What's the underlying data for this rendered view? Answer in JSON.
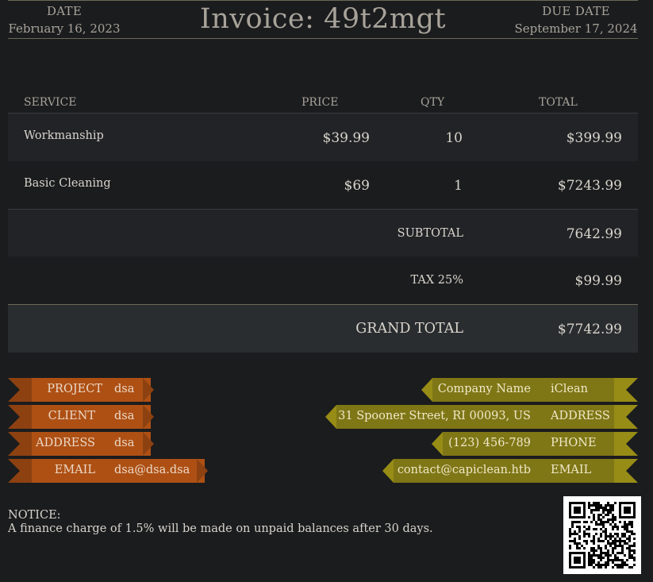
{
  "header": {
    "date_label": "DATE",
    "date_value": "February 16, 2023",
    "title": "Invoice: 49t2mgt",
    "due_label": "DUE DATE",
    "due_value": "September 17, 2024"
  },
  "table": {
    "columns": {
      "service": "SERVICE",
      "price": "PRICE",
      "qty": "QTY",
      "total": "TOTAL"
    },
    "rows": [
      {
        "service": "Workmanship",
        "price": "$39.99",
        "qty": "10",
        "total": "$399.99"
      },
      {
        "service": "Basic Cleaning",
        "price": "$69",
        "qty": "1",
        "total": "$7243.99"
      }
    ],
    "subtotal_label": "SUBTOTAL",
    "subtotal_value": "7642.99",
    "tax_label": "TAX 25%",
    "tax_value": "$99.99",
    "grand_label": "GRAND TOTAL",
    "grand_value": "$7742.99"
  },
  "client": {
    "project_label": "PROJECT",
    "project_value": "dsa",
    "client_label": "CLIENT",
    "client_value": "dsa",
    "address_label": "ADDRESS",
    "address_value": "dsa",
    "email_label": "EMAIL",
    "email_value": "dsa@dsa.dsa"
  },
  "company": {
    "name_label": "Company Name",
    "name_value": "iClean",
    "address_value": "31 Spooner Street, RI 00093, US",
    "address_label": "ADDRESS",
    "phone_value": "(123) 456-789",
    "phone_label": "PHONE",
    "email_value": "contact@capiclean.htb",
    "email_label": "EMAIL"
  },
  "notice": {
    "title": "NOTICE:",
    "text": "A finance charge of 1.5% will be made on unpaid balances after 30 days."
  },
  "colors": {
    "background": "#1b1c1e",
    "client_ribbon": "#ae5014",
    "company_ribbon": "#7f7616",
    "header_text": "#a8a39a"
  }
}
